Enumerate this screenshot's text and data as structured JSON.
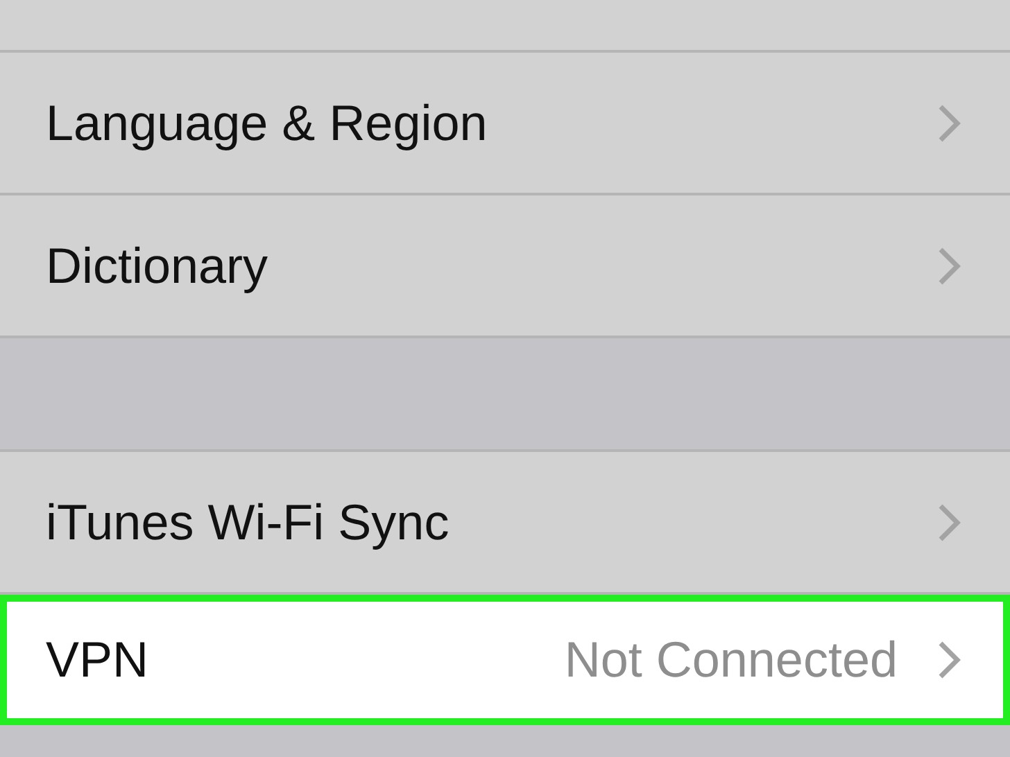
{
  "groups": [
    {
      "rows": [
        {
          "label": "Language & Region",
          "highlighted": false
        },
        {
          "label": "Dictionary",
          "highlighted": false
        }
      ]
    },
    {
      "rows": [
        {
          "label": "iTunes Wi-Fi Sync",
          "highlighted": false
        },
        {
          "label": "VPN",
          "value": "Not Connected",
          "highlighted": true
        }
      ]
    }
  ]
}
